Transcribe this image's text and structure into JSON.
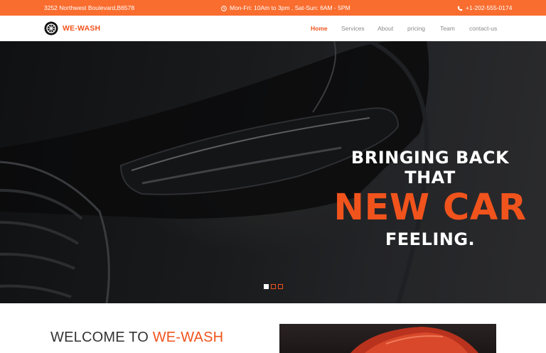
{
  "topbar": {
    "address": "3252 Northwest Boulevard,B6578",
    "hours": "Mon-Fri: 10Am to 3pm , Sat-Sun: 6AM - 5PM",
    "phone": "+1-202-555-0174"
  },
  "brand": {
    "name": "WE-WASH"
  },
  "nav": {
    "items": [
      {
        "label": "Home",
        "active": true
      },
      {
        "label": "Services",
        "active": false
      },
      {
        "label": "About",
        "active": false
      },
      {
        "label": "pricing",
        "active": false
      },
      {
        "label": "Team",
        "active": false
      },
      {
        "label": "contact-us",
        "active": false
      }
    ]
  },
  "hero": {
    "line1": "BRINGING BACK",
    "line2": "THAT",
    "line3": "NEW CAR",
    "line4": "FEELING.",
    "slides": 3,
    "active_slide": 1
  },
  "welcome": {
    "title_prefix": "WELCOME TO ",
    "title_brand": "WE-WASH"
  },
  "colors": {
    "accent": "#f1531d",
    "topbar": "#f96d2f",
    "nav_text": "#8a8a8a"
  },
  "icons": {
    "hours": "clock-icon",
    "phone": "phone-icon",
    "logo": "wheel-icon"
  }
}
